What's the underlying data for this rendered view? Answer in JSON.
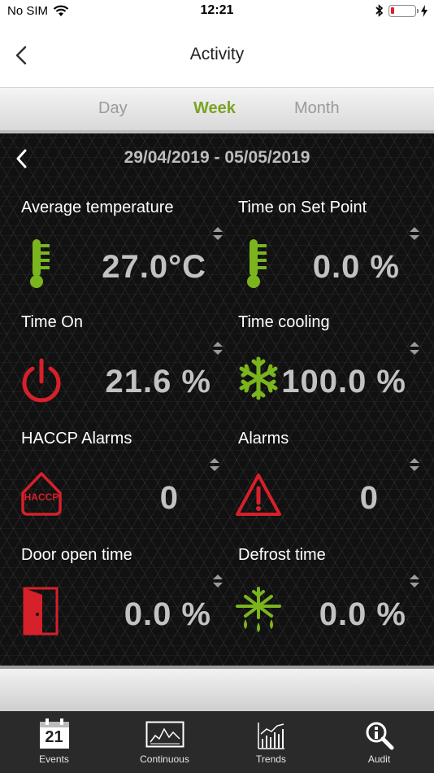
{
  "status_bar": {
    "carrier": "No SIM",
    "time": "12:21",
    "battery_level": 0.15,
    "battery_color": "#e5202a"
  },
  "nav": {
    "title": "Activity",
    "back_icon": "chevron-left-icon"
  },
  "tabs": [
    {
      "label": "Day",
      "active": false
    },
    {
      "label": "Week",
      "active": true
    },
    {
      "label": "Month",
      "active": false
    }
  ],
  "period": {
    "label": "29/04/2019 - 05/05/2019",
    "back_icon": "chevron-left-icon"
  },
  "stats": [
    {
      "label": "Average temperature",
      "value": "27.0°C",
      "icon": "thermometer-icon",
      "color": "#7ab51d"
    },
    {
      "label": "Time on Set Point",
      "value": "0.0 %",
      "icon": "thermometer-icon",
      "color": "#7ab51d"
    },
    {
      "label": "Time On",
      "value": "21.6 %",
      "icon": "power-icon",
      "color": "#d6202a"
    },
    {
      "label": "Time cooling",
      "value": "100.0 %",
      "icon": "snowflake-icon",
      "color": "#7ab51d"
    },
    {
      "label": "HACCP Alarms",
      "value": "0",
      "icon": "haccp-alarm-icon",
      "icon_text": "HACCP",
      "color": "#d6202a"
    },
    {
      "label": "Alarms",
      "value": "0",
      "icon": "alarm-warning-icon",
      "color": "#d6202a"
    },
    {
      "label": "Door open time",
      "value": "0.0 %",
      "icon": "door-open-icon",
      "color": "#d6202a"
    },
    {
      "label": "Defrost time",
      "value": "0.0 %",
      "icon": "defrost-icon",
      "color": "#7ab51d"
    }
  ],
  "tab_bar": [
    {
      "label": "Events",
      "icon": "calendar-icon",
      "icon_text": "21"
    },
    {
      "label": "Continuous",
      "icon": "continuous-chart-icon"
    },
    {
      "label": "Trends",
      "icon": "trends-chart-icon"
    },
    {
      "label": "Audit",
      "icon": "audit-search-icon"
    }
  ]
}
